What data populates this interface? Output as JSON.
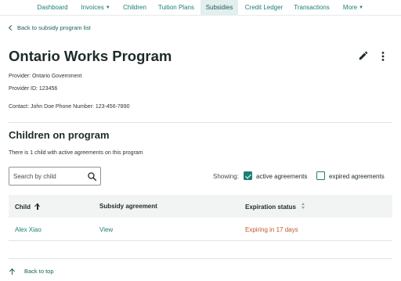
{
  "nav": {
    "items": [
      {
        "label": "Dashboard"
      },
      {
        "label": "Invoices",
        "has_caret": true
      },
      {
        "label": "Children"
      },
      {
        "label": "Tuition Plans"
      },
      {
        "label": "Subsidies",
        "active": true
      },
      {
        "label": "Credit Ledger"
      },
      {
        "label": "Transactions"
      },
      {
        "label": "More",
        "has_caret": true
      }
    ]
  },
  "back_link": "Back to subsidy program list",
  "program": {
    "title": "Ontario Works Program",
    "provider": "Provider: Ontario Government",
    "provider_id": "Provider ID: 123456",
    "contact": "Contact: John Doe Phone Number: 123-456-7890"
  },
  "children_section": {
    "title": "Children on program",
    "subtitle": "There is 1 child with active agreements on this program",
    "search_placeholder": "Search by child",
    "search_value": "",
    "showing_label": "Showing:",
    "filters": {
      "active": {
        "label": "active agreements",
        "checked": true
      },
      "expired": {
        "label": "expired agreements",
        "checked": false
      }
    }
  },
  "table": {
    "columns": [
      "Child",
      "Subsidy agreement",
      "Expiration status"
    ],
    "rows": [
      {
        "child": "Alex Xiao",
        "agreement": "View",
        "status": "Expiring in 17 days"
      }
    ]
  },
  "back_to_top": "Back to top",
  "colors": {
    "accent": "#1b7f73",
    "warning": "#c4562a",
    "nav_active_bg": "#e3eeee"
  }
}
